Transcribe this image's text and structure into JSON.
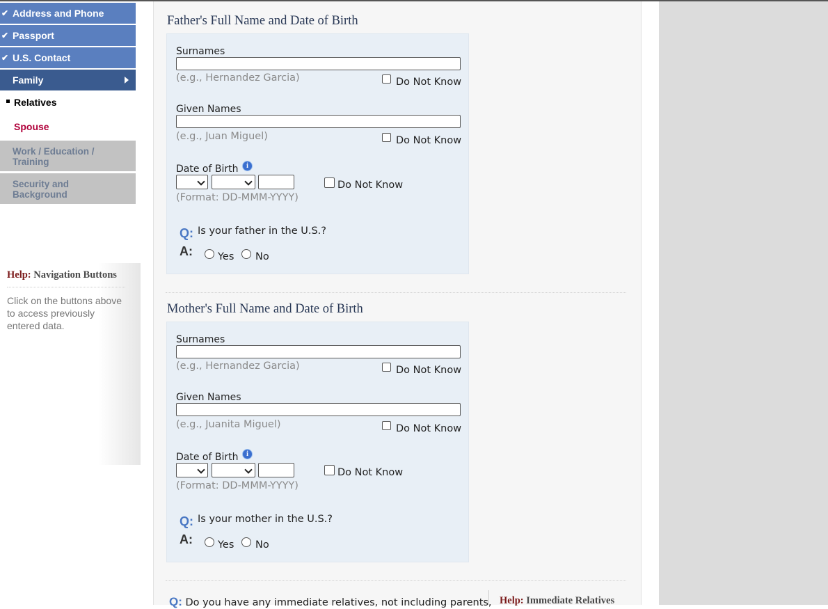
{
  "sidebar": {
    "completed": [
      {
        "label": "Address and Phone"
      },
      {
        "label": "Passport"
      },
      {
        "label": "U.S. Contact"
      }
    ],
    "current": "Family",
    "sub_items": [
      {
        "label": "Relatives",
        "color": "#000000"
      },
      {
        "label": "Spouse",
        "color": "#b0003a"
      }
    ],
    "disabled": [
      {
        "line1": "Work / Education /",
        "line2": "Training"
      },
      {
        "line1": "Security and",
        "line2": "Background"
      }
    ],
    "check_glyph": "✔"
  },
  "help": {
    "label": "Help:",
    "title": "Navigation Buttons",
    "text": "Click on the buttons above to access previously entered data."
  },
  "father": {
    "section_title": "Father's Full Name and Date of Birth",
    "surnames_label": "Surnames",
    "surnames_value": "",
    "surnames_hint": "(e.g., Hernandez Garcia)",
    "given_label": "Given Names",
    "given_value": "",
    "given_hint": "(e.g., Juan Miguel)",
    "dob_label": "Date of Birth",
    "dob_format": "(Format: DD-MMM-YYYY)",
    "do_not_know": "Do Not Know",
    "q_mark": "Q:",
    "a_mark": "A:",
    "question": "Is your father in the U.S.?",
    "yes": "Yes",
    "no": "No"
  },
  "mother": {
    "section_title": "Mother's Full Name and Date of Birth",
    "surnames_label": "Surnames",
    "surnames_value": "",
    "surnames_hint": "(e.g., Hernandez Garcia)",
    "given_label": "Given Names",
    "given_value": "",
    "given_hint": "(e.g., Juanita Miguel)",
    "dob_label": "Date of Birth",
    "dob_format": "(Format: DD-MMM-YYYY)",
    "do_not_know": "Do Not Know",
    "q_mark": "Q:",
    "a_mark": "A:",
    "question": "Is your mother in the U.S.?",
    "yes": "Yes",
    "no": "No"
  },
  "bottom": {
    "q_mark": "Q:",
    "question": "Do you have any immediate relatives, not including parents,",
    "help_label": "Help:",
    "help_title": "Immediate Relatives"
  },
  "colors": {
    "nav_done": "#5a7fbf",
    "nav_current": "#3a5b8f",
    "nav_disabled": "#c2c2c2",
    "panel": "#e8eff6",
    "help_label": "#7b1a1a"
  }
}
